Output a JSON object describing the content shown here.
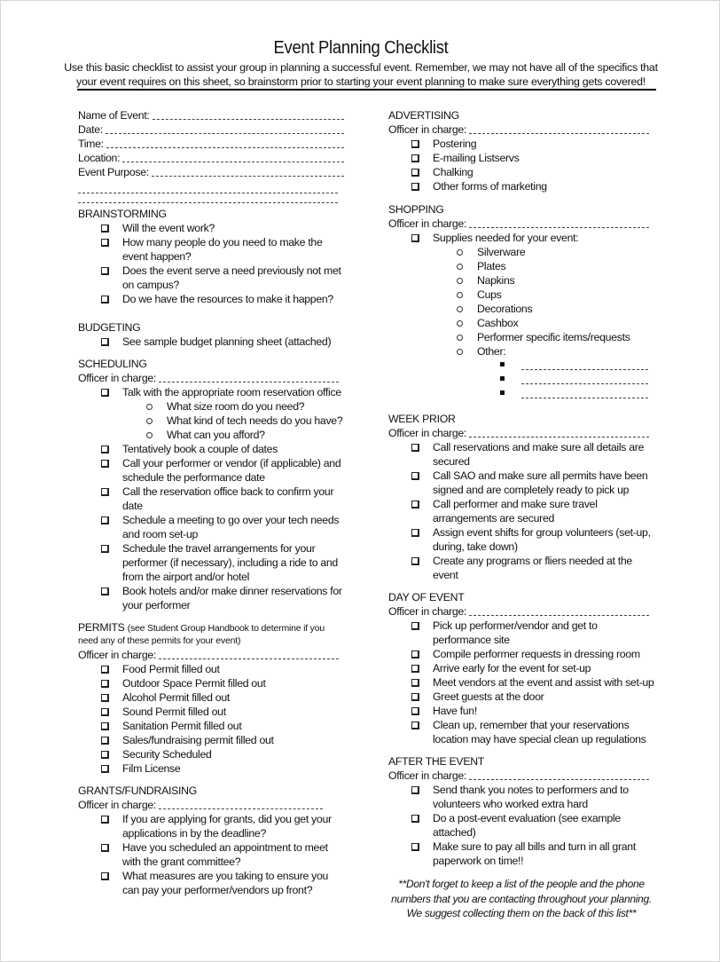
{
  "header": {
    "title": "Event Planning Checklist",
    "intro": "Use this basic checklist to assist your group in planning a successful event.  Remember, we may not have all of the specifics that your event requires on this sheet, so brainstorm prior to starting your event planning to make sure everything gets covered!"
  },
  "event_fields": {
    "name": "Name of Event:",
    "date": "Date:",
    "time": "Time:",
    "location": "Location:",
    "purpose": "Event Purpose:"
  },
  "officer_label": "Officer in charge:",
  "brainstorming": {
    "heading": "BRAINSTORMING",
    "items": [
      "Will the event work?",
      "How many people do you need to make the event happen?",
      "Does the event serve a need previously not met on campus?",
      "Do we have the resources to make it happen?"
    ]
  },
  "budgeting": {
    "heading": "BUDGETING",
    "items": [
      "See sample budget planning sheet (attached)"
    ]
  },
  "scheduling": {
    "heading": "SCHEDULING",
    "items": [
      "Talk with the appropriate room reservation office",
      "Tentatively book a couple of dates",
      "Call your performer or vendor (if applicable) and schedule the performance date",
      "Call the reservation office back to confirm your date",
      "Schedule a meeting to go over your tech needs and room set-up",
      "Schedule the travel arrangements for your performer (if necessary), including a ride to and from the airport and/or hotel",
      "Book hotels and/or make dinner reservations for your performer"
    ],
    "room_subitems": [
      "What size room do you need?",
      "What kind of tech needs do you have?",
      "What can you afford?"
    ]
  },
  "permits": {
    "heading": "PERMITS",
    "heading_note": "(see Student Group Handbook to determine if you",
    "note_line2": "need any of these permits for your event)",
    "items": [
      "Food Permit filled out",
      "Outdoor Space Permit filled out",
      "Alcohol Permit filled out",
      "Sound Permit filled out",
      "Sanitation Permit filled out",
      "Sales/fundraising permit filled out",
      "Security Scheduled",
      "Film License"
    ]
  },
  "grants": {
    "heading": "GRANTS/FUNDRAISING",
    "items": [
      "If you are applying for grants, did you get your applications in by the deadline?",
      "Have you scheduled an appointment to meet with the grant committee?",
      "What measures are you taking to ensure you can pay your performer/vendors up front?"
    ]
  },
  "advertising": {
    "heading": "ADVERTISING",
    "items": [
      "Postering",
      "E-mailing Listservs",
      "Chalking",
      "Other forms of marketing"
    ]
  },
  "shopping": {
    "heading": "SHOPPING",
    "item": "Supplies needed for your event:",
    "supplies": [
      "Silverware",
      "Plates",
      "Napkins",
      "Cups",
      "Decorations",
      "Cashbox",
      "Performer specific items/requests",
      "Other:"
    ]
  },
  "week_prior": {
    "heading": "WEEK PRIOR",
    "items": [
      "Call reservations and make sure all details are secured",
      "Call SAO and make sure all permits have been signed and are completely ready to pick up",
      "Call performer and make sure travel arrangements are secured",
      "Assign event shifts for group volunteers (set-up, during, take down)",
      "Create any programs or fliers needed at the event"
    ]
  },
  "day_of_event": {
    "heading": "DAY OF EVENT",
    "items": [
      "Pick up performer/vendor and get to performance site",
      "Compile performer requests in dressing room",
      "Arrive early for the event for set-up",
      "Meet vendors at the event and assist with set-up",
      "Greet guests at the door",
      "Have fun!",
      "Clean up, remember that your reservations location may have special clean up regulations"
    ]
  },
  "after_event": {
    "heading": "AFTER THE EVENT",
    "items": [
      "Send thank you notes to performers and to volunteers who worked extra hard",
      "Do a post-event evaluation (see example attached)",
      "Make sure to pay all bills and turn in all grant paperwork on time!!"
    ]
  },
  "footer_note": "**Don't forget to keep a list of the people and the phone numbers that you are contacting throughout your planning. We suggest collecting them on the back of this list**"
}
